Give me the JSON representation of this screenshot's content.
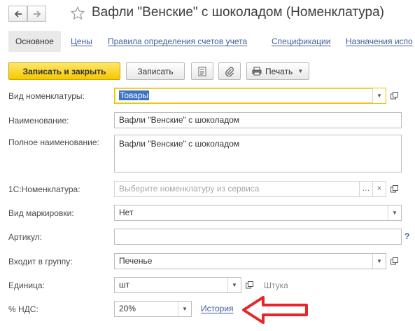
{
  "window": {
    "title": "Вафли \"Венские\" с шоколадом (Номенклатура)",
    "star_icon": "star-outline-icon"
  },
  "tabs": [
    {
      "label": "Основное"
    },
    {
      "label": "Цены"
    },
    {
      "label": "Правила определения счетов учета"
    },
    {
      "label": "Спецификации"
    },
    {
      "label": "Назначения испо"
    }
  ],
  "toolbar": {
    "save_close_label": "Записать и закрыть",
    "save_label": "Записать",
    "print_label": "Печать"
  },
  "form": {
    "vid_nomenklatury": {
      "label": "Вид номенклатуры:",
      "value": "Товары"
    },
    "naimenovanie": {
      "label": "Наименование:",
      "value": "Вафли \"Венские\" с шоколадом"
    },
    "polnoe": {
      "label": "Полное наименование:",
      "value": "Вафли \"Венские\" с шоколадом"
    },
    "nom_1c": {
      "label": "1С:Номенклатура:",
      "placeholder": "Выберите номенклатуру из сервиса"
    },
    "markirovka": {
      "label": "Вид маркировки:",
      "value": "Нет"
    },
    "artikul": {
      "label": "Артикул:",
      "value": "",
      "help": "?"
    },
    "gruppa": {
      "label": "Входит в группу:",
      "value": "Печенье"
    },
    "edinica": {
      "label": "Единица:",
      "value": "шт",
      "description": "Штука"
    },
    "nds": {
      "label": "% НДС:",
      "value": "20%",
      "history_link": "История"
    }
  },
  "annotation": {
    "color": "#e8262a"
  }
}
